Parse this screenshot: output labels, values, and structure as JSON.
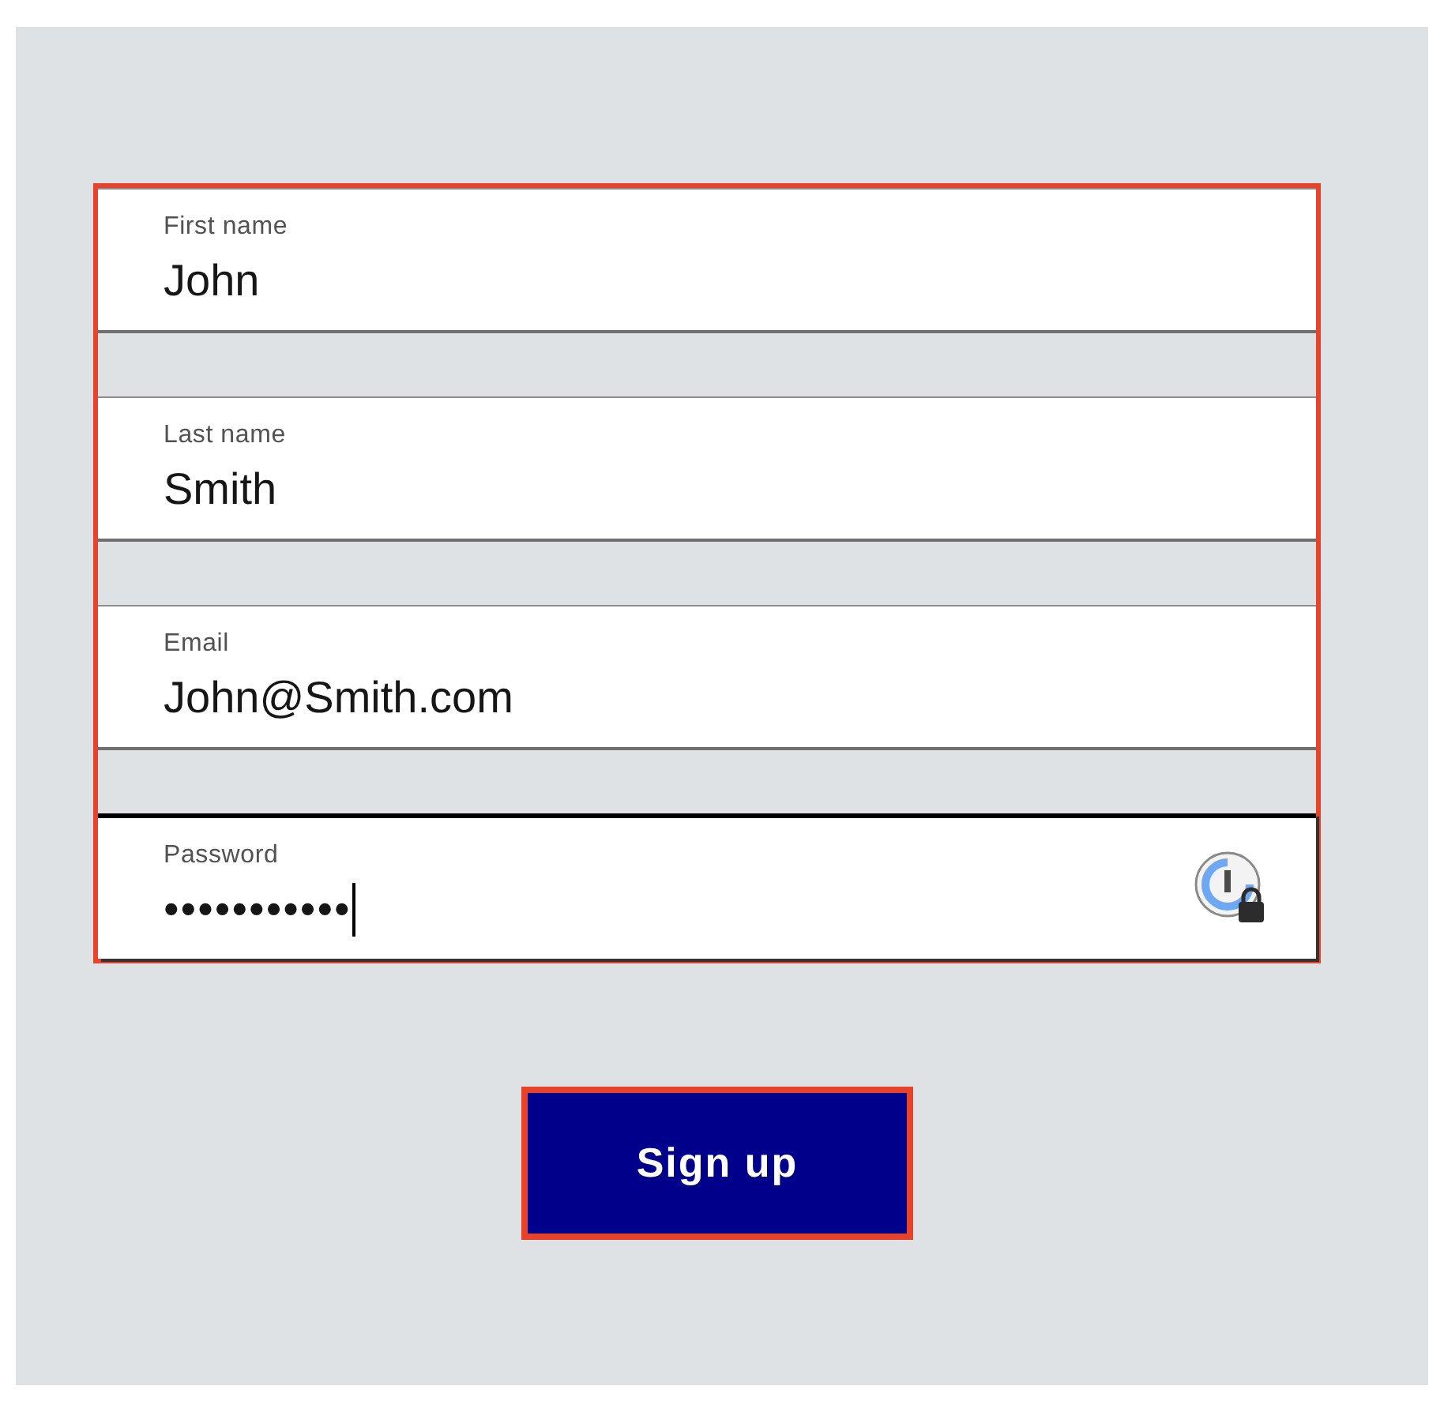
{
  "fields": [
    {
      "label": "First name",
      "value": "John",
      "focused": false,
      "kind": "text"
    },
    {
      "label": "Last name",
      "value": "Smith",
      "focused": false,
      "kind": "text"
    },
    {
      "label": "Email",
      "value": "John@Smith.com",
      "focused": false,
      "kind": "text"
    },
    {
      "label": "Password",
      "value": "•••••••••••",
      "focused": true,
      "kind": "password"
    }
  ],
  "submit_button": "Sign up"
}
